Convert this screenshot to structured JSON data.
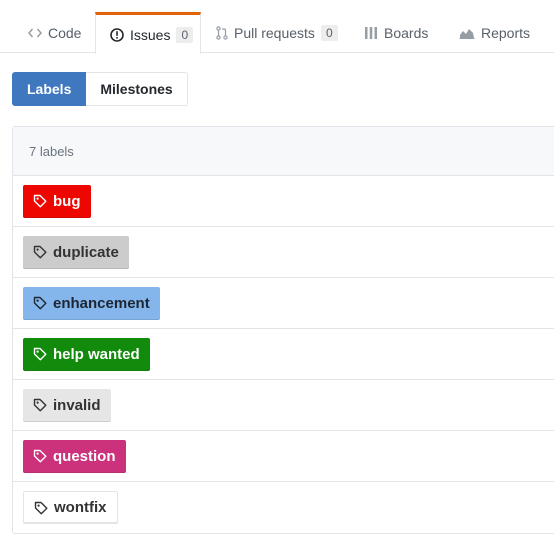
{
  "tabs": [
    {
      "label": "Code",
      "icon": "code-icon"
    },
    {
      "label": "Issues",
      "icon": "issue-opened-icon",
      "counter": "0",
      "selected": true
    },
    {
      "label": "Pull requests",
      "icon": "git-pull-request-icon",
      "counter": "0"
    },
    {
      "label": "Boards",
      "icon": "project-icon"
    },
    {
      "label": "Reports",
      "icon": "graph-icon"
    }
  ],
  "subnav": {
    "labels": "Labels",
    "milestones": "Milestones"
  },
  "box": {
    "count_text": "7 labels"
  },
  "labels": [
    {
      "name": "bug",
      "bg": "#ee0701",
      "fg": "#ffffff"
    },
    {
      "name": "duplicate",
      "bg": "#cccccc",
      "fg": "#333333"
    },
    {
      "name": "enhancement",
      "bg": "#84b6eb",
      "fg": "#1c2733"
    },
    {
      "name": "help wanted",
      "bg": "#128a0c",
      "fg": "#ffffff"
    },
    {
      "name": "invalid",
      "bg": "#e6e6e6",
      "fg": "#333333"
    },
    {
      "name": "question",
      "bg": "#cc317c",
      "fg": "#ffffff"
    },
    {
      "name": "wontfix",
      "bg": "#ffffff",
      "fg": "#333333"
    }
  ],
  "colors": {
    "accent": "#4078c0",
    "tab_selected_border": "#e36209"
  }
}
